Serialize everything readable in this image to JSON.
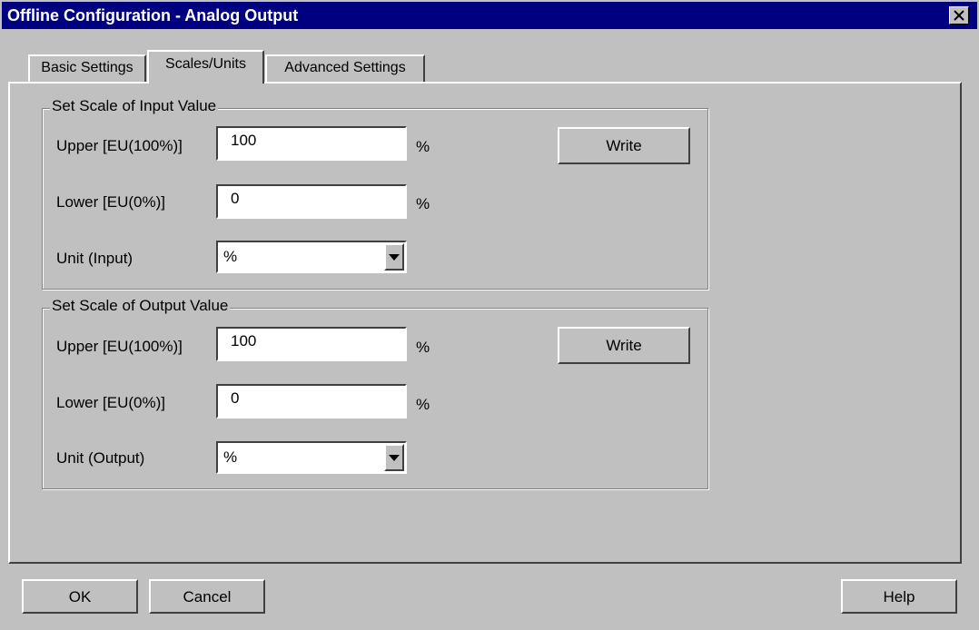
{
  "window": {
    "title": "Offline Configuration - Analog Output"
  },
  "tabs": [
    {
      "label": "Basic Settings"
    },
    {
      "label": "Scales/Units",
      "active": true
    },
    {
      "label": "Advanced Settings"
    }
  ],
  "input_scale": {
    "group_label": "Set Scale of Input Value",
    "upper_label": "Upper [EU(100%)]",
    "upper_value": "100",
    "upper_unit": "%",
    "lower_label": "Lower [EU(0%)]",
    "lower_value": "0",
    "lower_unit": "%",
    "unit_label": "Unit (Input)",
    "unit_value": "%",
    "write_label": "Write"
  },
  "output_scale": {
    "group_label": "Set Scale of Output Value",
    "upper_label": "Upper [EU(100%)]",
    "upper_value": "100",
    "upper_unit": "%",
    "lower_label": "Lower [EU(0%)]",
    "lower_value": "0",
    "lower_unit": "%",
    "unit_label": "Unit (Output)",
    "unit_value": "%",
    "write_label": "Write"
  },
  "footer": {
    "ok_label": "OK",
    "cancel_label": "Cancel",
    "help_label": "Help"
  },
  "colors": {
    "titlebar": "#000080",
    "face": "#c0c0c0"
  }
}
